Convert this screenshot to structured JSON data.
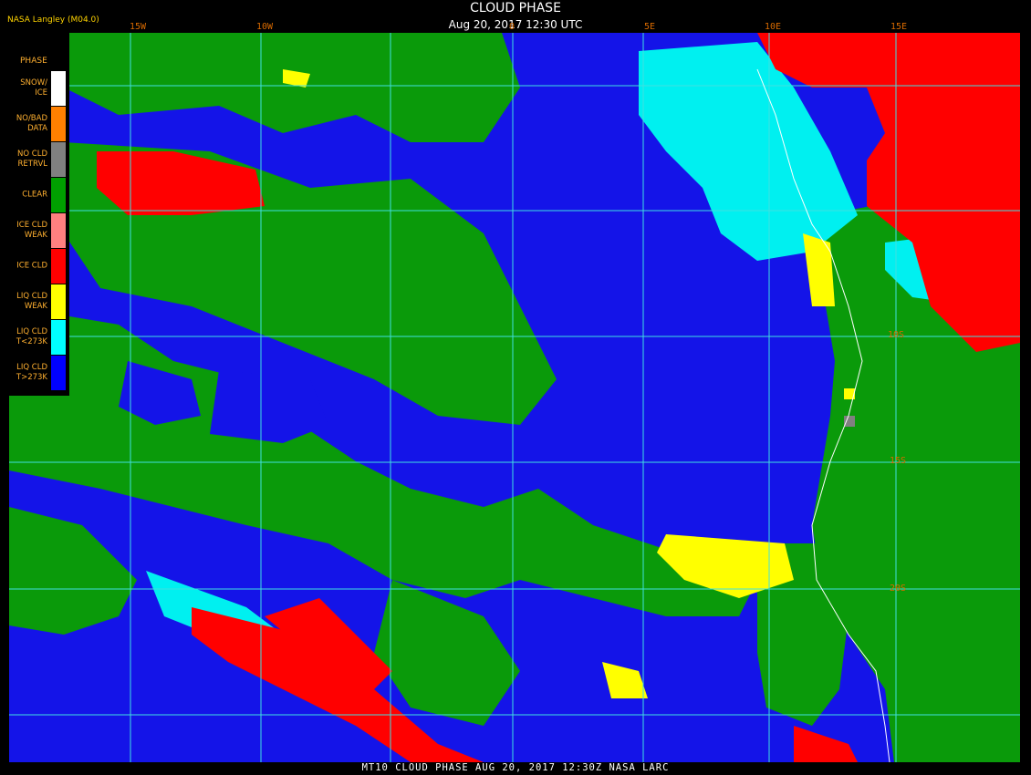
{
  "header": {
    "title": "CLOUD PHASE",
    "date": "Aug 20, 2017 12:30 UTC",
    "credit": "NASA Langley (M04.0)"
  },
  "longitude_labels": [
    "15W",
    "10W",
    "0",
    "5E",
    "10E",
    "15E"
  ],
  "latitude_labels": [
    "10S",
    "15S",
    "20S"
  ],
  "legend": {
    "title": "PHASE",
    "items": [
      {
        "label": "SNOW/ ICE",
        "color": "#ffffff"
      },
      {
        "label": "NO/BAD DATA",
        "color": "#ff8000"
      },
      {
        "label": "NO CLD RETRVL",
        "color": "#808080"
      },
      {
        "label": "CLEAR",
        "color": "#00a000"
      },
      {
        "label": "ICE CLD WEAK",
        "color": "#ff8080"
      },
      {
        "label": "ICE CLD",
        "color": "#ff0000"
      },
      {
        "label": "LIQ CLD WEAK",
        "color": "#ffff00"
      },
      {
        "label": "LIQ CLD T<273K",
        "color": "#00ffff"
      },
      {
        "label": "LIQ CLD T>273K",
        "color": "#0000ff"
      }
    ]
  },
  "footer": {
    "text": "MT10  CLOUD PHASE   AUG 20, 2017 12:30Z   NASA LARC"
  }
}
